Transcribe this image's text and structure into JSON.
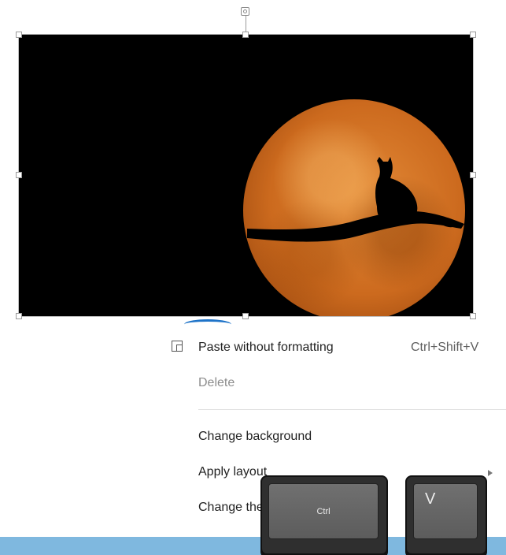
{
  "image": {
    "icon": "cat-on-branch-moon-image"
  },
  "context_menu": {
    "items": [
      {
        "label": "Paste without formatting",
        "shortcut": "Ctrl+Shift+V"
      },
      {
        "label": "Delete"
      },
      {
        "label": "Change background"
      },
      {
        "label": "Apply layout"
      },
      {
        "label": "Change theme"
      }
    ]
  },
  "keys": {
    "ctrl": "Ctrl",
    "v": "V"
  },
  "colors": {
    "moon": "#d5772a",
    "image_bg": "#000000",
    "highlight_arc": "#1e73c8",
    "bottom_bar": "#7fb8df"
  }
}
